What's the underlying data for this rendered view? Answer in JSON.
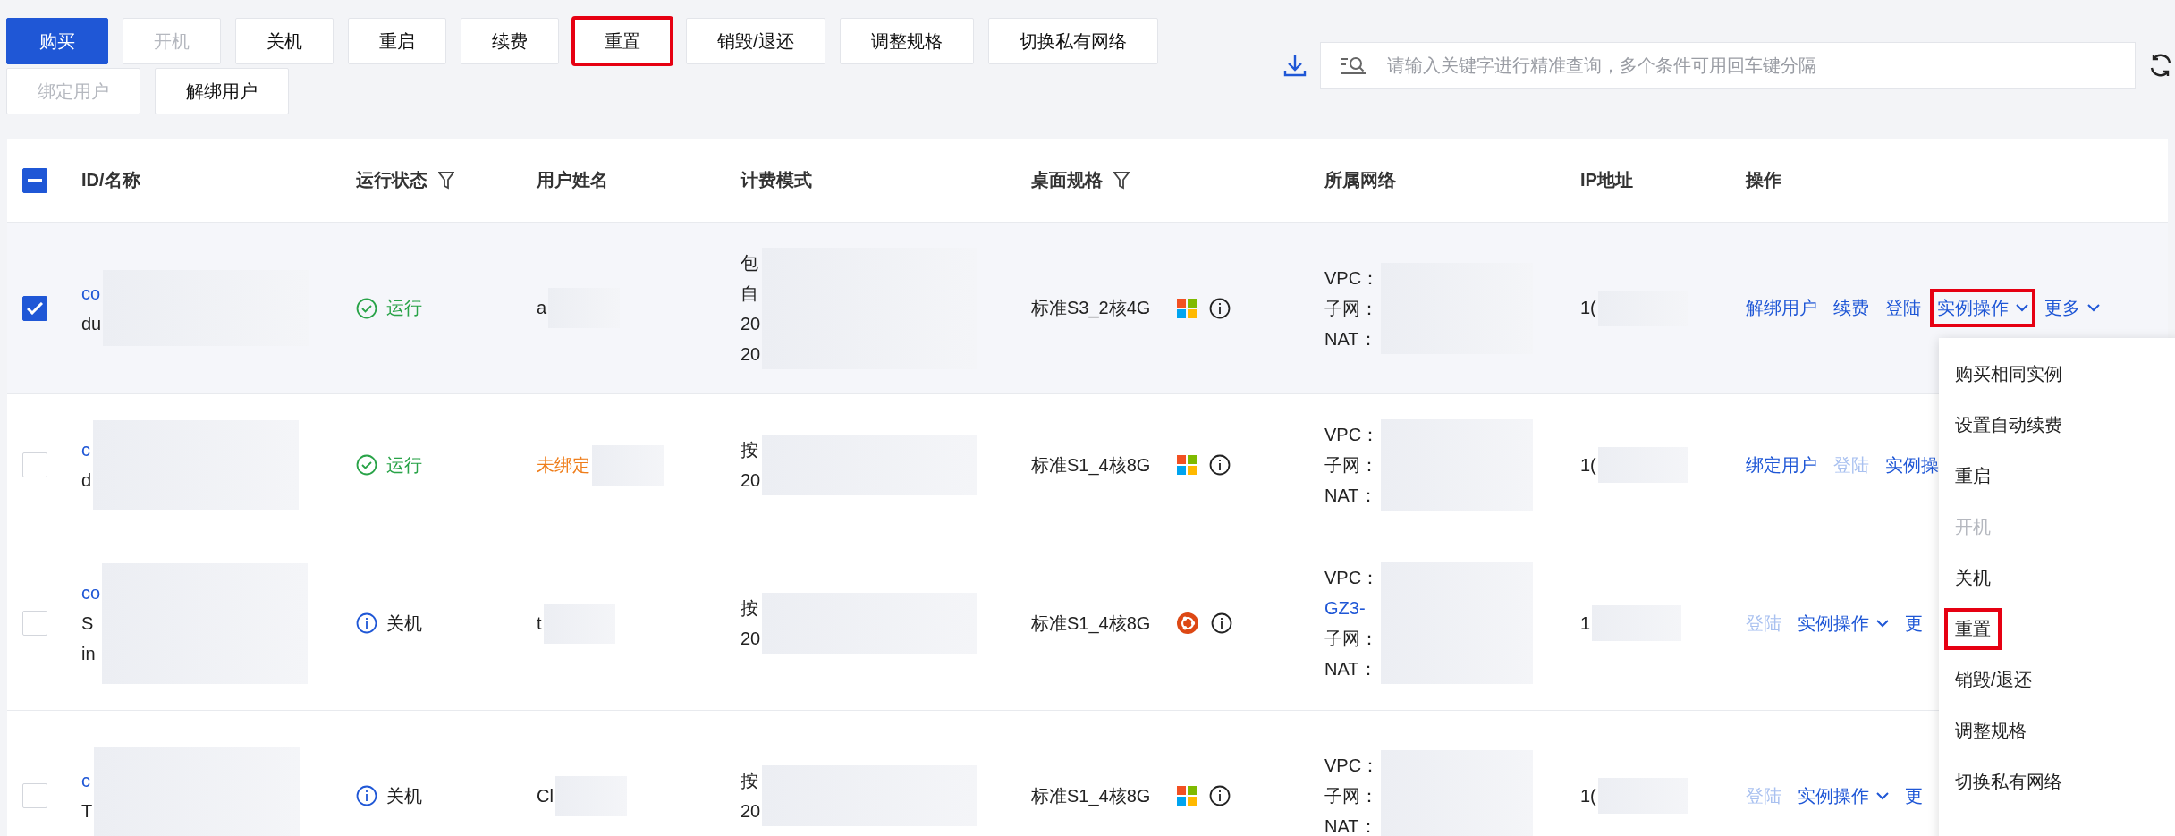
{
  "toolbar": {
    "buttons": [
      {
        "label": "购买",
        "kind": "primary",
        "disabled": false,
        "highlighted": false
      },
      {
        "label": "开机",
        "kind": "default",
        "disabled": true,
        "highlighted": false
      },
      {
        "label": "关机",
        "kind": "default",
        "disabled": false,
        "highlighted": false
      },
      {
        "label": "重启",
        "kind": "default",
        "disabled": false,
        "highlighted": false
      },
      {
        "label": "续费",
        "kind": "default",
        "disabled": false,
        "highlighted": false
      },
      {
        "label": "重置",
        "kind": "default",
        "disabled": false,
        "highlighted": true
      },
      {
        "label": "销毁/退还",
        "kind": "default",
        "disabled": false,
        "highlighted": false
      },
      {
        "label": "调整规格",
        "kind": "default",
        "disabled": false,
        "highlighted": false
      },
      {
        "label": "切换私有网络",
        "kind": "default",
        "disabled": false,
        "highlighted": false
      },
      {
        "label": "绑定用户",
        "kind": "default",
        "disabled": true,
        "highlighted": false
      },
      {
        "label": "解绑用户",
        "kind": "default",
        "disabled": false,
        "highlighted": false
      }
    ],
    "search": {
      "placeholder": "请输入关键字进行精准查询，多个条件可用回车键分隔"
    }
  },
  "table": {
    "select_all": {
      "checked": true,
      "indeterminate": true
    },
    "columns": [
      {
        "label": "ID/名称",
        "filter": false
      },
      {
        "label": "运行状态",
        "filter": true
      },
      {
        "label": "用户姓名",
        "filter": false
      },
      {
        "label": "计费模式",
        "filter": false
      },
      {
        "label": "桌面规格",
        "filter": true
      },
      {
        "label": "所属网络",
        "filter": false
      },
      {
        "label": "IP地址",
        "filter": false
      },
      {
        "label": "操作",
        "filter": false
      }
    ],
    "rows": [
      {
        "selected": true,
        "id_lines": [
          "co",
          "du"
        ],
        "status": {
          "kind": "running",
          "label": "运行"
        },
        "user": {
          "kind": "normal",
          "text": "a"
        },
        "billing": [
          "包",
          "自",
          "20",
          "20"
        ],
        "spec": "标准S3_2核4G",
        "os_icon": {
          "kind": "windows"
        },
        "network": [
          {
            "kind": "label",
            "text": "VPC："
          },
          {
            "kind": "label",
            "text": "子网："
          },
          {
            "kind": "label",
            "text": "NAT："
          }
        ],
        "ip": "1(",
        "actions": [
          {
            "kind": "link",
            "label": "解绑用户",
            "disabled": false,
            "highlighted": false
          },
          {
            "kind": "link",
            "label": "续费",
            "disabled": false,
            "highlighted": false
          },
          {
            "kind": "link",
            "label": "登陆",
            "disabled": false,
            "highlighted": false
          },
          {
            "kind": "dropdown",
            "label": "实例操作",
            "disabled": false,
            "highlighted": true
          },
          {
            "kind": "dropdown",
            "label": "更多",
            "disabled": false,
            "highlighted": false
          }
        ]
      },
      {
        "selected": false,
        "id_lines": [
          "c",
          "d"
        ],
        "status": {
          "kind": "running",
          "label": "运行"
        },
        "user": {
          "kind": "unbound",
          "text": "未绑定"
        },
        "billing": [
          "按",
          "20"
        ],
        "spec": "标准S1_4核8G",
        "os_icon": {
          "kind": "windows"
        },
        "network": [
          {
            "kind": "label",
            "text": "VPC："
          },
          {
            "kind": "label",
            "text": "子网："
          },
          {
            "kind": "label",
            "text": "NAT："
          }
        ],
        "ip": "1(",
        "actions": [
          {
            "kind": "link",
            "label": "绑定用户",
            "disabled": false,
            "highlighted": false
          },
          {
            "kind": "link",
            "label": "登陆",
            "disabled": true,
            "highlighted": false
          },
          {
            "kind": "link",
            "label": "实例操",
            "disabled": false,
            "highlighted": false
          }
        ]
      },
      {
        "selected": false,
        "id_lines": [
          "co",
          "S",
          "in"
        ],
        "status": {
          "kind": "off",
          "label": "关机"
        },
        "user": {
          "kind": "normal",
          "text": "t"
        },
        "billing": [
          "按",
          "20"
        ],
        "spec": "标准S1_4核8G",
        "os_icon": {
          "kind": "ubuntu"
        },
        "network": [
          {
            "kind": "label",
            "text": "VPC："
          },
          {
            "kind": "link",
            "text": "GZ3-"
          },
          {
            "kind": "label",
            "text": "子网："
          },
          {
            "kind": "label",
            "text": "NAT："
          }
        ],
        "ip": "1",
        "actions": [
          {
            "kind": "link",
            "label": "登陆",
            "disabled": true,
            "highlighted": false
          },
          {
            "kind": "dropdown",
            "label": "实例操作",
            "disabled": false,
            "highlighted": false
          },
          {
            "kind": "link",
            "label": "更",
            "disabled": false,
            "highlighted": false
          }
        ]
      },
      {
        "selected": false,
        "id_lines": [
          "c",
          "T"
        ],
        "status": {
          "kind": "off",
          "label": "关机"
        },
        "user": {
          "kind": "normal",
          "text": "Cl"
        },
        "billing": [
          "按",
          "20"
        ],
        "spec": "标准S1_4核8G",
        "os_icon": {
          "kind": "windows"
        },
        "network": [
          {
            "kind": "label",
            "text": "VPC："
          },
          {
            "kind": "label",
            "text": "子网："
          },
          {
            "kind": "label",
            "text": "NAT："
          }
        ],
        "ip": "1(",
        "actions": [
          {
            "kind": "link",
            "label": "登陆",
            "disabled": true,
            "highlighted": false
          },
          {
            "kind": "dropdown",
            "label": "实例操作",
            "disabled": false,
            "highlighted": false
          },
          {
            "kind": "link",
            "label": "更",
            "disabled": false,
            "highlighted": false
          }
        ]
      }
    ]
  },
  "dropdown_menu": {
    "items": [
      {
        "label": "购买相同实例",
        "disabled": false,
        "highlighted": false
      },
      {
        "label": "设置自动续费",
        "disabled": false,
        "highlighted": false
      },
      {
        "label": "重启",
        "disabled": false,
        "highlighted": false
      },
      {
        "label": "开机",
        "disabled": true,
        "highlighted": false
      },
      {
        "label": "关机",
        "disabled": false,
        "highlighted": false
      },
      {
        "label": "重置",
        "disabled": false,
        "highlighted": true
      },
      {
        "label": "销毁/退还",
        "disabled": false,
        "highlighted": false
      },
      {
        "label": "调整规格",
        "disabled": false,
        "highlighted": false
      },
      {
        "label": "切换私有网络",
        "disabled": false,
        "highlighted": false
      }
    ]
  }
}
